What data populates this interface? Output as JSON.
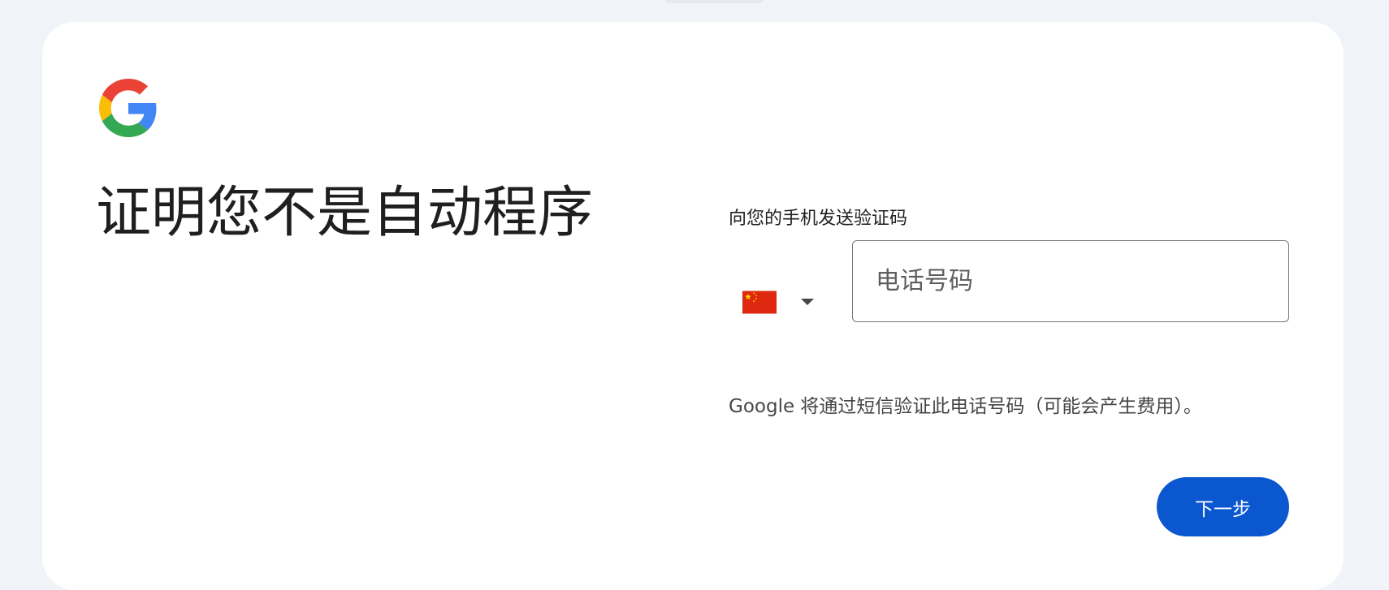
{
  "logo": {
    "icon": "google-g-logo-icon"
  },
  "page": {
    "title": "证明您不是自动程序",
    "subtitle": "向您的手机发送验证码"
  },
  "phone": {
    "country_flag_icon": "china-flag-icon",
    "dropdown_icon": "caret-down-icon",
    "placeholder": "电话号码",
    "value": ""
  },
  "notice": "Google 将通过短信验证此电话号码（可能会产生费用）。",
  "actions": {
    "next_label": "下一步"
  },
  "colors": {
    "background": "#f0f4f9",
    "card": "#ffffff",
    "primary": "#0b57d0",
    "text": "#1f1f1f",
    "secondary_text": "#444746",
    "border": "#747775",
    "flag_red": "#de2910",
    "flag_yellow": "#ffde00"
  }
}
